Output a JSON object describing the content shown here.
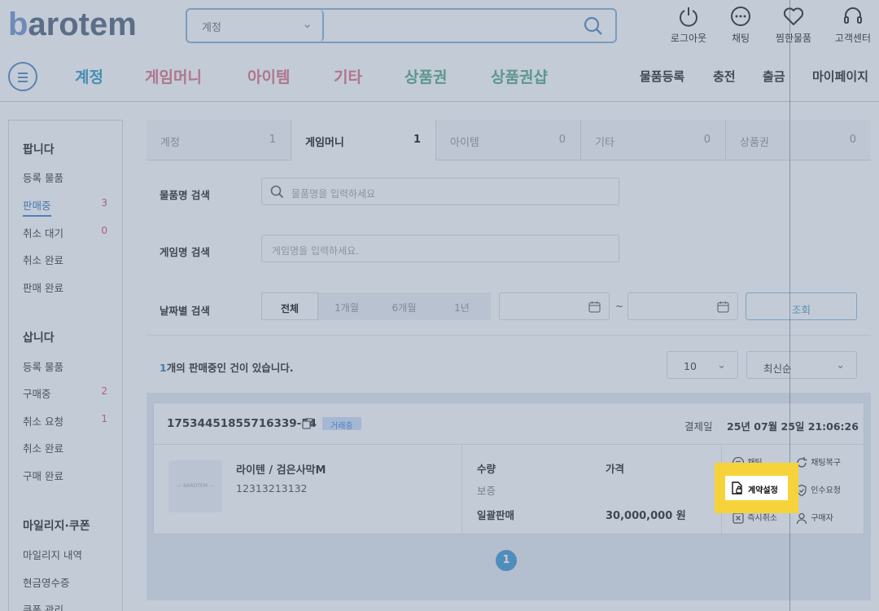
{
  "header": {
    "logo_b": "b",
    "logo_rest": "arotem",
    "search": {
      "select_value": "계정",
      "placeholder": ""
    },
    "icons": [
      {
        "label": "로그아웃",
        "icon": "power-icon"
      },
      {
        "label": "채팅",
        "icon": "chat-icon"
      },
      {
        "label": "찜한물품",
        "icon": "heart-icon"
      },
      {
        "label": "고객센터",
        "icon": "headset-icon"
      }
    ]
  },
  "nav": {
    "categories": [
      {
        "label": "계정",
        "color": "#3d9ec6"
      },
      {
        "label": "게임머니",
        "color": "#e07a8a"
      },
      {
        "label": "아이템",
        "color": "#e07a8a"
      },
      {
        "label": "기타",
        "color": "#e07a8a"
      },
      {
        "label": "상품권",
        "color": "#5fae8c"
      },
      {
        "label": "상품권샵",
        "color": "#5fae8c"
      }
    ],
    "right": [
      "물품등록",
      "충전",
      "출금",
      "마이페이지"
    ]
  },
  "sidebar": {
    "sell_title": "팝니다",
    "sell_items": [
      {
        "label": "등록 물품",
        "count": ""
      },
      {
        "label": "판매중",
        "count": "3"
      },
      {
        "label": "취소 대기",
        "count": "0"
      },
      {
        "label": "취소 완료",
        "count": ""
      },
      {
        "label": "판매 완료",
        "count": ""
      }
    ],
    "buy_title": "삽니다",
    "buy_items": [
      {
        "label": "등록 물품",
        "count": ""
      },
      {
        "label": "구매중",
        "count": "2"
      },
      {
        "label": "취소 요청",
        "count": "1"
      },
      {
        "label": "취소 완료",
        "count": ""
      },
      {
        "label": "구매 완료",
        "count": ""
      }
    ],
    "mileage_title": "마일리지·쿠폰",
    "mileage_items": [
      "마일리지 내역",
      "현금영수증",
      "쿠폰 관리"
    ]
  },
  "tabs": [
    {
      "label": "계정",
      "count": "1"
    },
    {
      "label": "게임머니",
      "count": "1"
    },
    {
      "label": "아이템",
      "count": "0"
    },
    {
      "label": "기타",
      "count": "0"
    },
    {
      "label": "상품권",
      "count": "0"
    }
  ],
  "filters": {
    "item_label": "물품명 검색",
    "item_placeholder": "물품명을 입력하세요",
    "game_label": "게임명 검색",
    "game_placeholder": "게임명을 입력하세요.",
    "date_label": "날짜별 검색",
    "periods": [
      "전체",
      "1개월",
      "6개월",
      "1년"
    ],
    "tilde": "~",
    "search_button": "조회"
  },
  "results": {
    "count_num": "1",
    "count_text": "개의 판매중인 건이 있습니다.",
    "per_page": "10",
    "sort": "최신순"
  },
  "order": {
    "id": "1753445185571633­9-54",
    "status_badge": "거래중",
    "date_label": "결제일",
    "date_value": "25년 07월 25일 21:06:26",
    "thumb_text": "— BAROTEM —",
    "title": "라이텐 / 검은사막M",
    "code": "12313213132",
    "qty_label": "수량",
    "qty_value": "보증",
    "price_label": "가격",
    "sale_type": "일괄판매",
    "price_value": "30,000,000 원",
    "actions": {
      "chat": "채팅",
      "chat_restore": "채팅복구",
      "contract": "계약설정",
      "receive": "인수요청",
      "cancel": "즉시취소",
      "buyer": "구매자"
    }
  },
  "pagination": {
    "current": "1"
  }
}
